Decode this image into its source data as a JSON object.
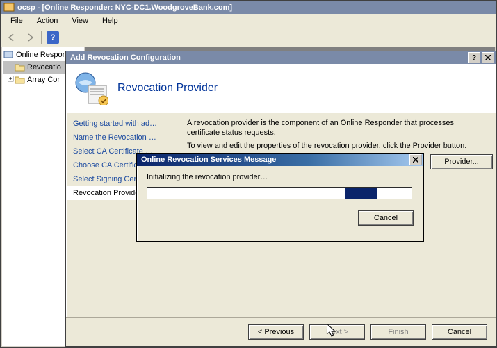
{
  "mmc": {
    "title": "ocsp - [Online Responder: NYC-DC1.WoodgroveBank.com]",
    "menu": {
      "file": "File",
      "action": "Action",
      "view": "View",
      "help": "Help"
    },
    "tree": {
      "root": "Online Respor",
      "node1": "Revocatio",
      "node2": "Array Cor"
    }
  },
  "wizard": {
    "title": "Add Revocation Configuration",
    "heading": "Revocation Provider",
    "nav": [
      "Getting started with ad…",
      "Name the Revocation …",
      "Select CA Certificate …",
      "Choose CA Certificate",
      "Select Signing Certific…",
      "Revocation Provider"
    ],
    "content_line1": "A revocation provider is the component of an Online Responder that processes certificate status requests.",
    "content_line2": "To view and edit the properties of the revocation provider, click the Provider button.",
    "provider_button": "Provider...",
    "buttons": {
      "previous": "< Previous",
      "next": "Next >",
      "finish": "Finish",
      "cancel": "Cancel"
    }
  },
  "msg": {
    "title": "Online Revocation Services Message",
    "text": "Initializing the revocation provider…",
    "progress_left_pct": 75,
    "progress_width_pct": 12,
    "cancel": "Cancel"
  }
}
